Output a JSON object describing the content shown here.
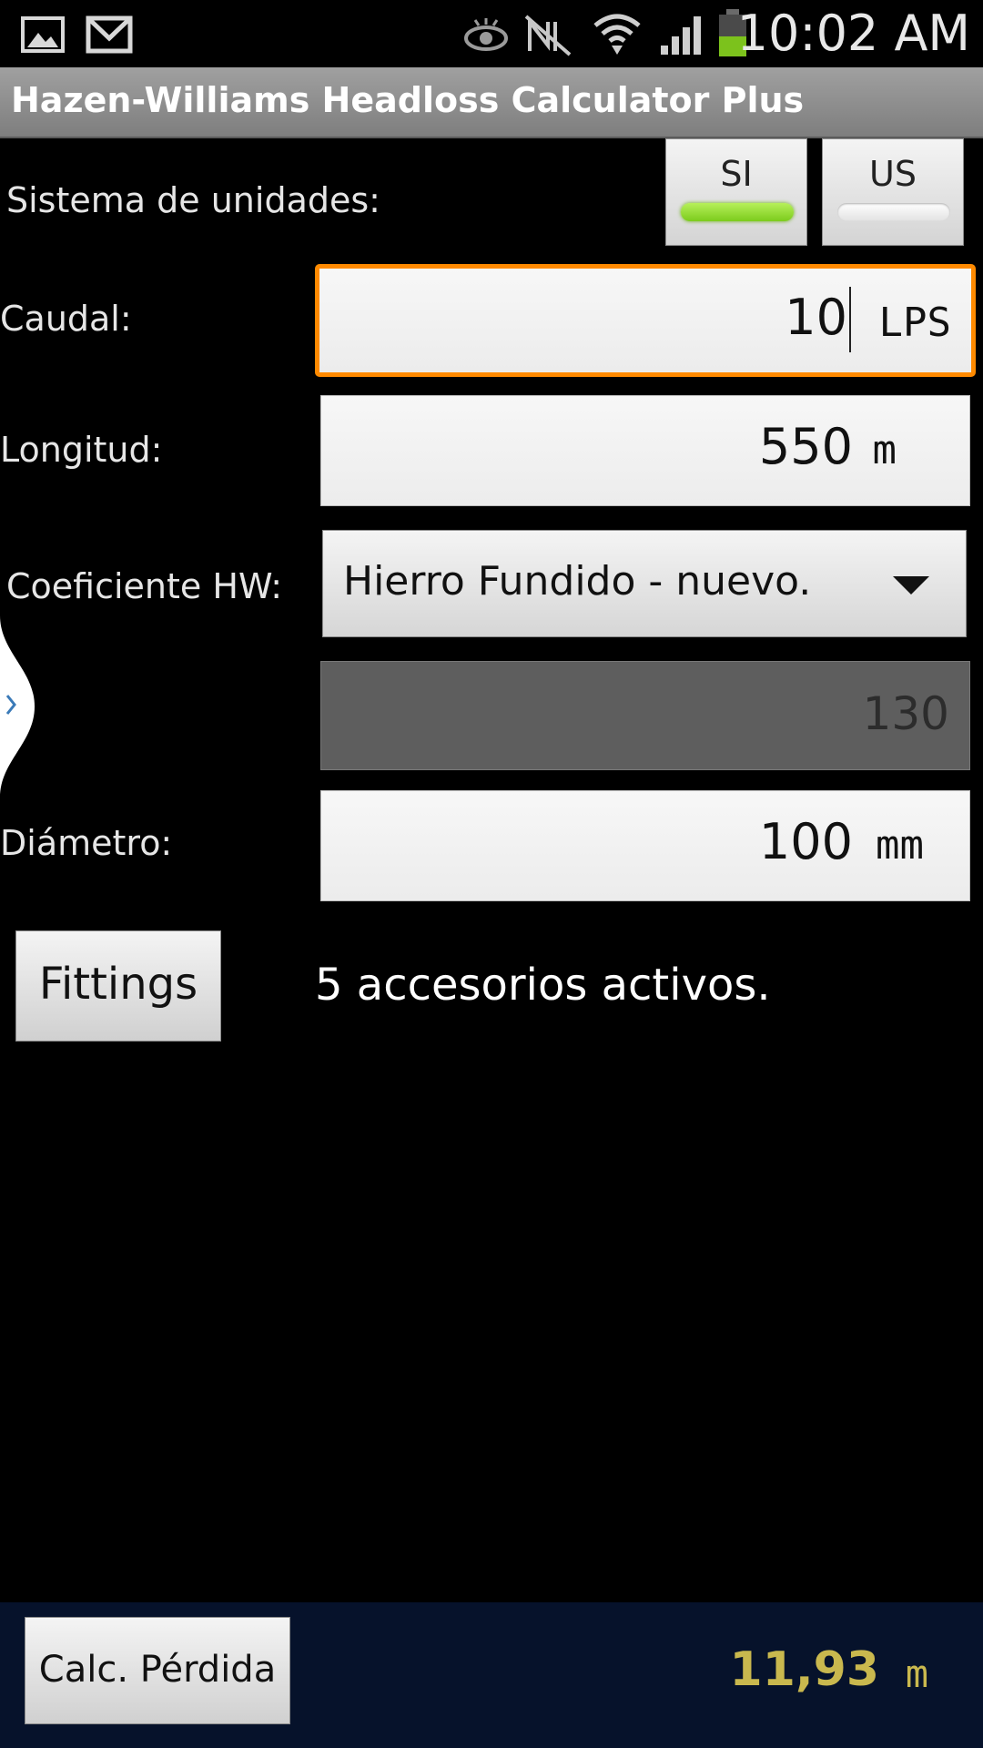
{
  "status_bar": {
    "time": "10:02 AM",
    "icons": [
      "gallery-icon",
      "gmail-icon",
      "eye-icon",
      "nfc-off-icon",
      "wifi-icon",
      "signal-icon",
      "battery-icon"
    ]
  },
  "app": {
    "title": "Hazen-Williams Headloss Calculator Plus"
  },
  "units": {
    "label": "Sistema de unidades:",
    "options": [
      {
        "label": "SI",
        "selected": true
      },
      {
        "label": "US",
        "selected": false
      }
    ]
  },
  "flow": {
    "label": "Caudal:",
    "value": "10",
    "unit": "LPS"
  },
  "length": {
    "label": "Longitud:",
    "value": "550",
    "unit": "m"
  },
  "hw_coefficient": {
    "label": "Coeficiente HW:",
    "selected_material": "Hierro Fundido - nuevo.",
    "value": "130"
  },
  "diameter": {
    "label": "Diámetro:",
    "value": "100",
    "unit": "mm"
  },
  "fittings": {
    "button_label": "Fittings",
    "status": "5 accesorios activos."
  },
  "result": {
    "button_label": "Calc. Pérdida",
    "value": "11,93",
    "unit": "m"
  },
  "colors": {
    "focus": "#ff8a00",
    "selected_indicator": "#7ccb1c",
    "result_text": "#c9b84e",
    "bottom_bar": "#06122b"
  }
}
